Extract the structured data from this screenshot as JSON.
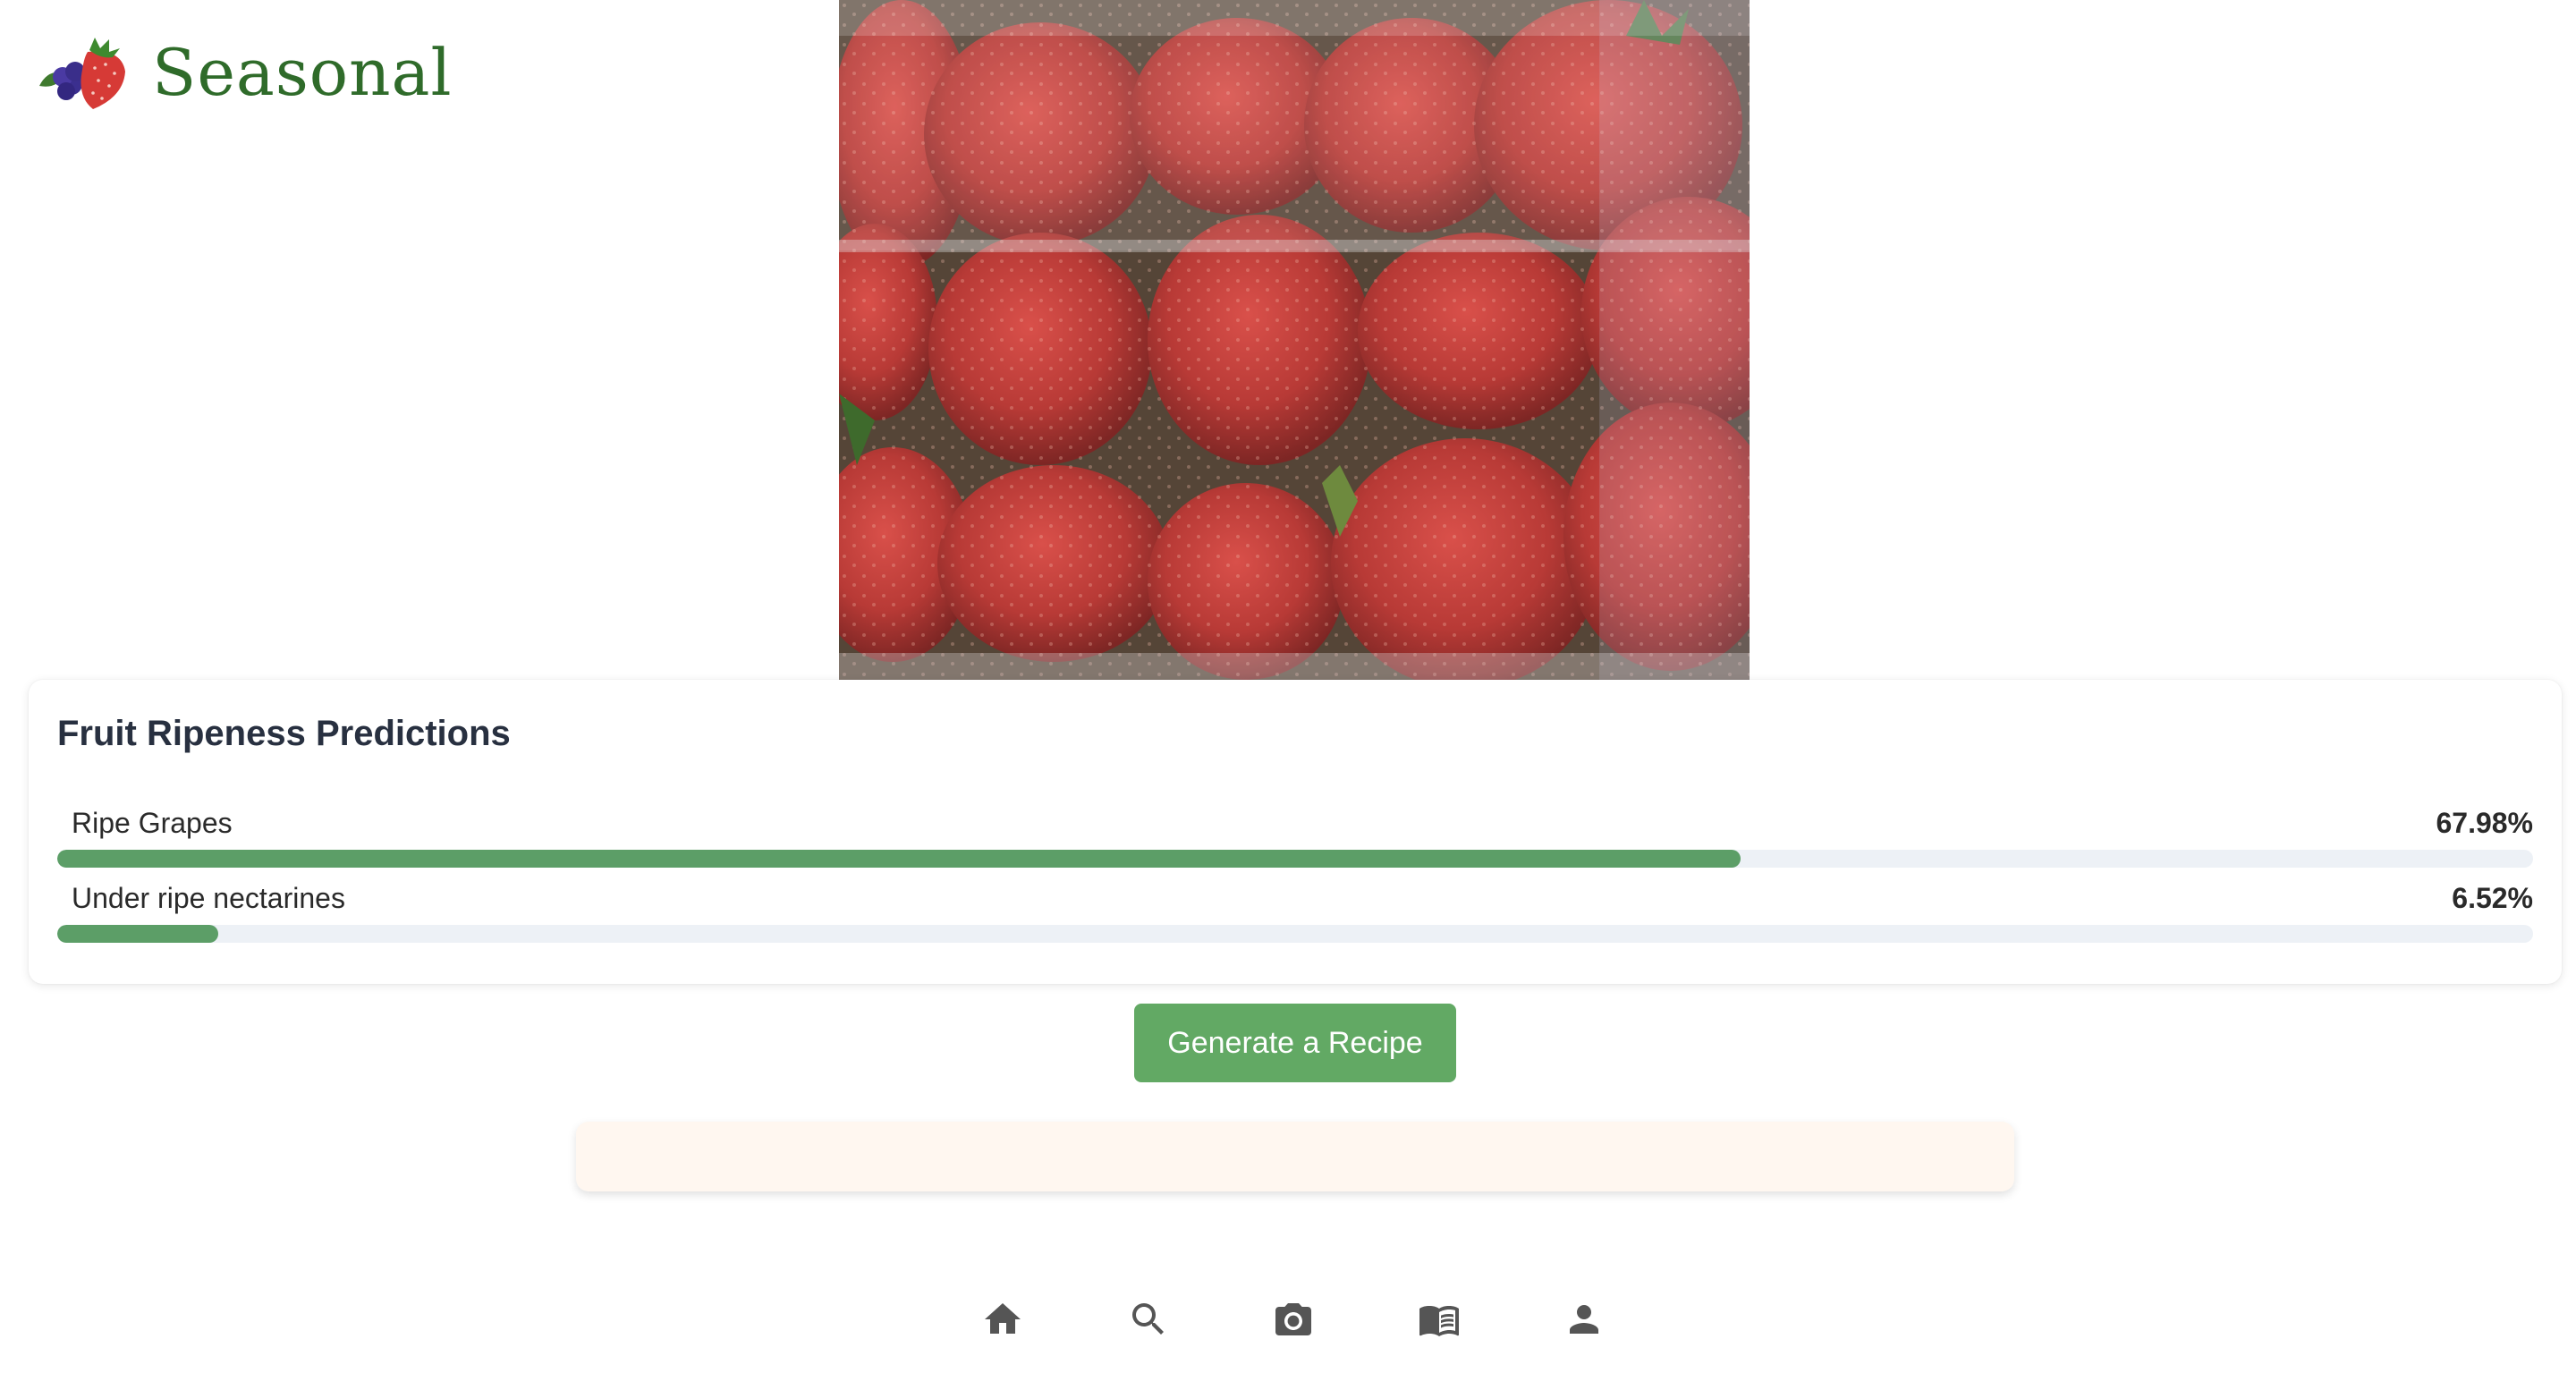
{
  "brand": {
    "name": "Seasonal",
    "color": "#2f6b2a"
  },
  "photo": {
    "subject": "strawberries-photo"
  },
  "predictions": {
    "title": "Fruit Ripeness Predictions",
    "bar_color": "#5c9e67",
    "items": [
      {
        "label": "Ripe Grapes",
        "value_text": "67.98%",
        "percent": 67.98
      },
      {
        "label": "Under ripe nectarines",
        "value_text": "6.52%",
        "percent": 6.52
      }
    ]
  },
  "actions": {
    "generate_label": "Generate a Recipe",
    "button_color": "#62a964"
  },
  "nav": {
    "items": [
      {
        "icon": "home-icon"
      },
      {
        "icon": "search-icon"
      },
      {
        "icon": "camera-icon"
      },
      {
        "icon": "recipe-book-icon"
      },
      {
        "icon": "profile-icon"
      }
    ]
  }
}
